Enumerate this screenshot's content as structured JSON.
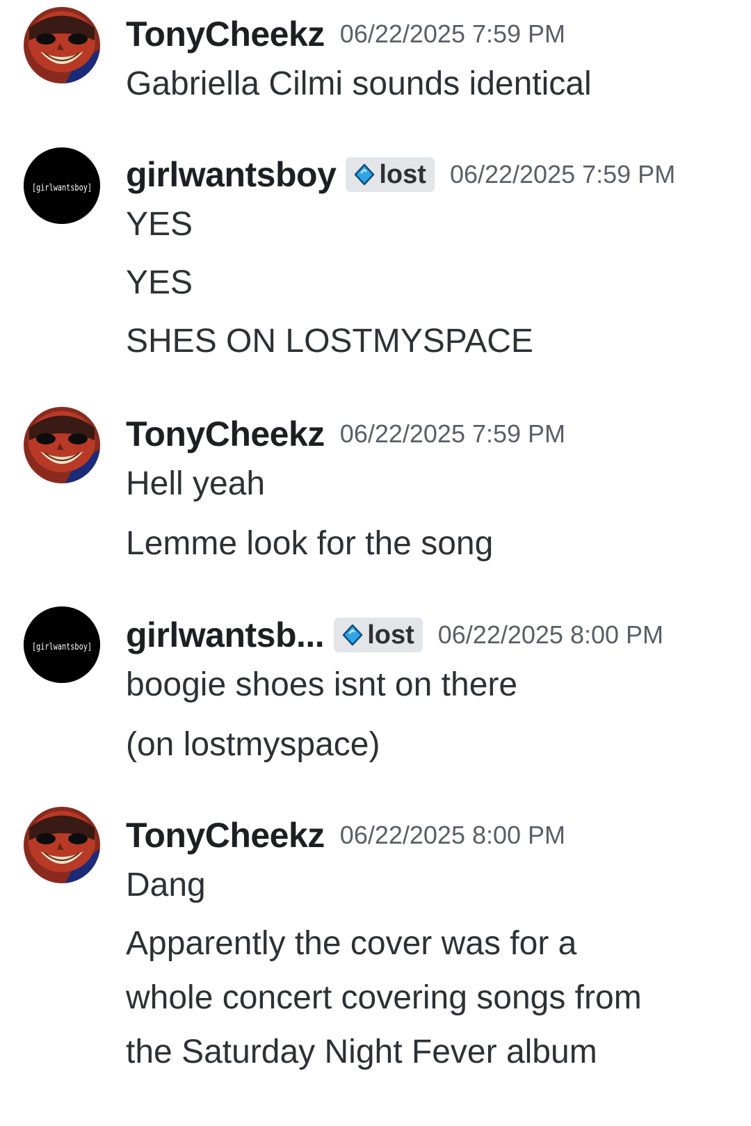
{
  "messages": [
    {
      "author": "TonyCheekz",
      "timestamp": "06/22/2025 7:59 PM",
      "lines": [
        "Gabriella Cilmi sounds identical"
      ]
    },
    {
      "author": "girlwantsboy",
      "tag": "lost",
      "avatar_text": "[girlwantsboy]",
      "timestamp": "06/22/2025 7:59 PM",
      "lines": [
        "YES",
        "YES",
        "SHES ON LOSTMYSPACE"
      ]
    },
    {
      "author": "TonyCheekz",
      "timestamp": "06/22/2025 7:59 PM",
      "lines": [
        "Hell yeah",
        "Lemme look for the song"
      ]
    },
    {
      "author": "girlwantsb...",
      "tag": "lost",
      "avatar_text": "[girlwantsboy]",
      "timestamp": "06/22/2025 8:00 PM",
      "lines": [
        "boogie shoes isnt on there",
        "(on lostmyspace)"
      ]
    },
    {
      "author": "TonyCheekz",
      "timestamp": "06/22/2025 8:00 PM",
      "lines": [
        "Dang",
        "Apparently the cover was for a",
        "whole concert covering songs from",
        "the Saturday Night Fever album"
      ]
    }
  ],
  "colors": {
    "background": "#ffffff",
    "username": "#1e1f22",
    "timestamp": "#5c5e66",
    "tag_bg": "#e3e5e8",
    "tag_icon": "#2fa4e7"
  }
}
